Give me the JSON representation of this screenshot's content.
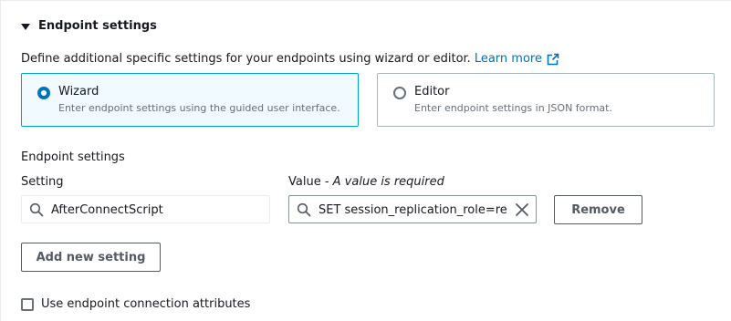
{
  "section": {
    "title": "Endpoint settings",
    "expanded": true
  },
  "description": {
    "text": "Define additional specific settings for your endpoints using wizard or editor.",
    "link_label": "Learn more",
    "link_icon": "external-link-icon"
  },
  "mode_tiles": [
    {
      "title": "Wizard",
      "description": "Enter endpoint settings using the guided user interface.",
      "selected": true
    },
    {
      "title": "Editor",
      "description": "Enter endpoint settings in JSON format.",
      "selected": false
    }
  ],
  "settings_group": {
    "heading": "Endpoint settings",
    "setting_label": "Setting",
    "value_label_prefix": "Value - ",
    "value_label_hint": "A value is required",
    "rows": [
      {
        "setting": "AfterConnectScript",
        "value": "SET session_replication_role=replica",
        "remove_label": "Remove"
      }
    ],
    "add_label": "Add new setting"
  },
  "connection_attributes": {
    "label": "Use endpoint connection attributes",
    "checked": false
  },
  "colors": {
    "link": "#0073bb",
    "selected_border": "#00a1c9",
    "selected_bg": "#f1faff",
    "text": "#16191f",
    "muted": "#687078"
  }
}
